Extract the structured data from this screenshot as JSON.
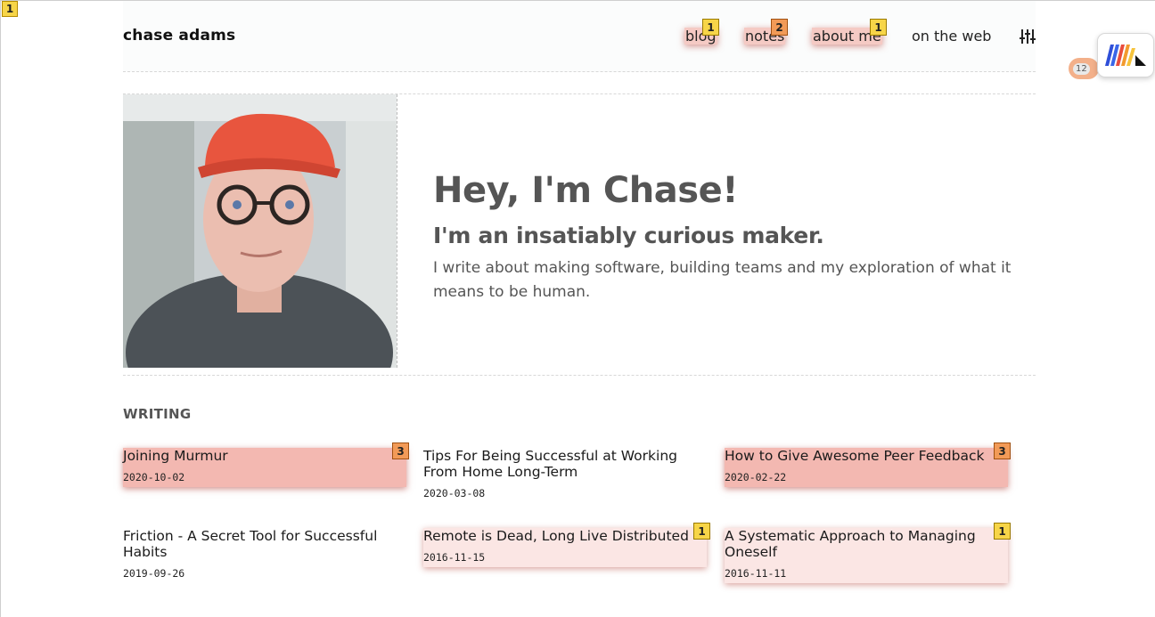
{
  "page_marker": "1",
  "site": {
    "brand": "chase adams"
  },
  "nav": [
    {
      "label": "blog",
      "badge": "1"
    },
    {
      "label": "notes",
      "badge": "2"
    },
    {
      "label": "about me",
      "badge": "1"
    },
    {
      "label": "on the web"
    }
  ],
  "settings_icon": "sliders-icon",
  "extension": {
    "count": "12",
    "icon": "extension-logo-icon"
  },
  "hero": {
    "title": "Hey, I'm Chase!",
    "subtitle": "I'm an insatiably curious maker.",
    "description": "I write about making software, building teams and my exploration of what it means to be human."
  },
  "writing": {
    "heading": "WRITING",
    "posts": [
      {
        "title": "Joining Murmur",
        "date": "2020-10-02",
        "badge": "3"
      },
      {
        "title": "Tips For Being Successful at Working From Home Long-Term",
        "date": "2020-03-08"
      },
      {
        "title": "How to Give Awesome Peer Feedback",
        "date": "2020-02-22",
        "badge": "3"
      },
      {
        "title": "Friction - A Secret Tool for Successful Habits",
        "date": "2019-09-26"
      },
      {
        "title": "Remote is Dead, Long Live Distributed",
        "date": "2016-11-15",
        "badge": "1"
      },
      {
        "title": "A Systematic Approach to Managing Oneself",
        "date": "2016-11-11",
        "badge": "1"
      }
    ]
  },
  "colors": {
    "highlight_strong": "#f0a096",
    "highlight_light": "#f8d2cd",
    "badge_yellow": "#f7d548",
    "badge_orange": "#f29a57",
    "text_muted": "#555555"
  }
}
